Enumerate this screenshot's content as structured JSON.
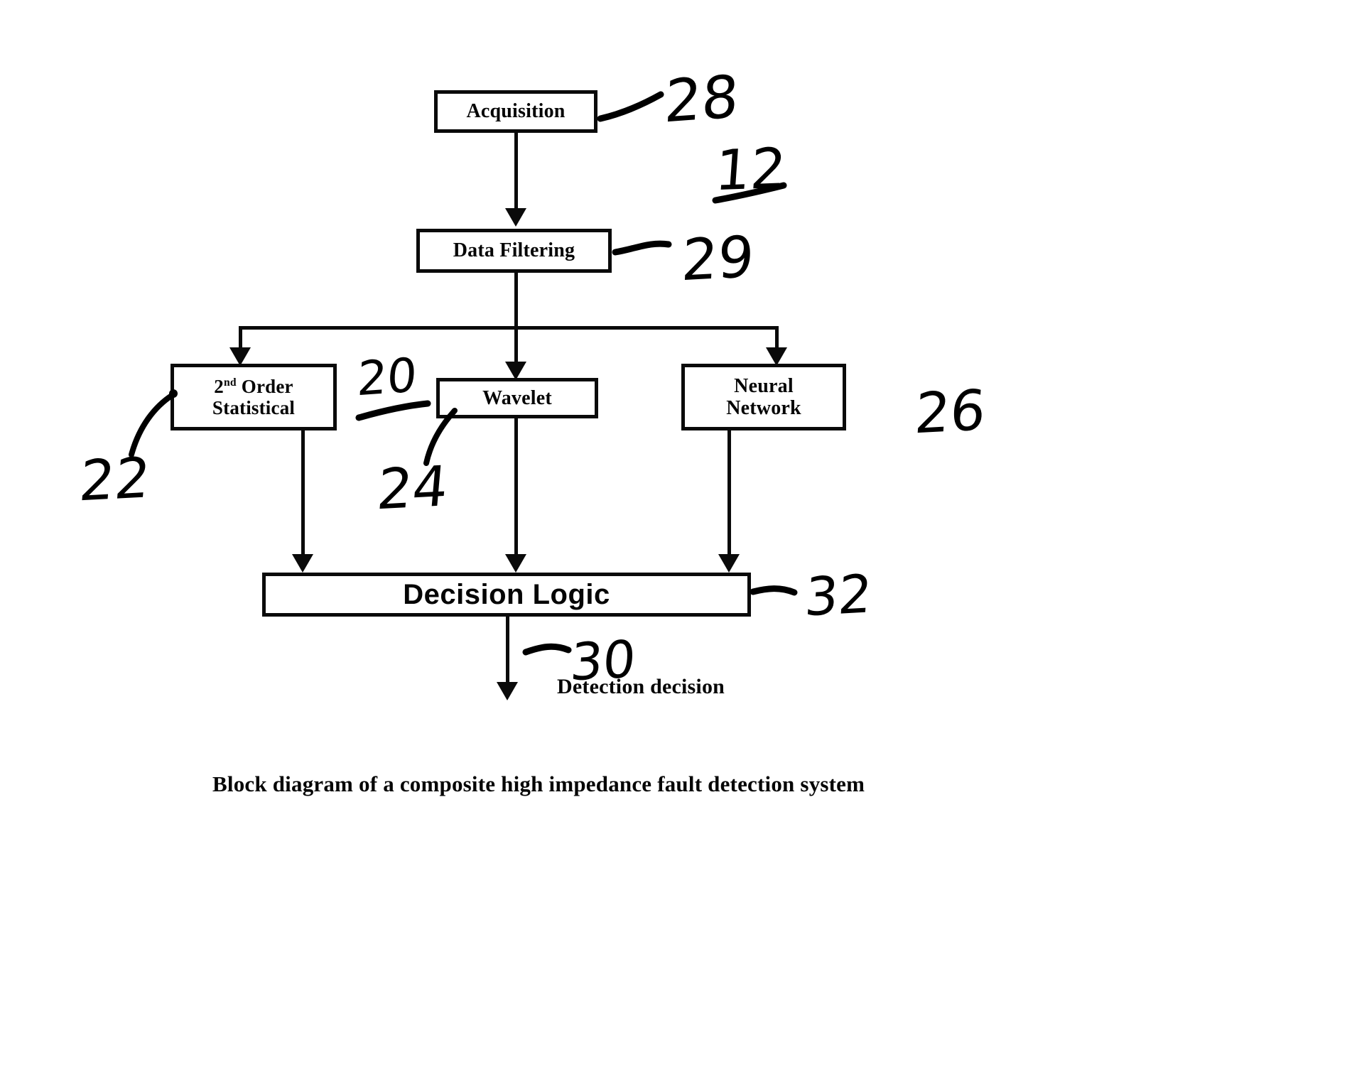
{
  "figure": {
    "caption": "Block diagram of a composite high impedance fault detection system",
    "output_label": "Detection decision"
  },
  "blocks": [
    {
      "id": "acquisition",
      "label": "Acquisition",
      "ref": "28"
    },
    {
      "id": "data_filtering",
      "label": "Data Filtering",
      "ref": "29"
    },
    {
      "id": "second_order",
      "label_line1": "2",
      "label_sup": "nd",
      "label_line1b": " Order",
      "label_line2": "Statistical",
      "ref": "22"
    },
    {
      "id": "wavelet",
      "label": "Wavelet",
      "ref": "24"
    },
    {
      "id": "neural",
      "label_line1": "Neural",
      "label_line2": "Network",
      "ref": "26"
    },
    {
      "id": "decision",
      "label": "Decision Logic",
      "ref": "32"
    }
  ],
  "reference_numerals": {
    "system": "12",
    "analysis_group": "20",
    "second_order": "22",
    "wavelet": "24",
    "neural_network": "26",
    "acquisition": "28",
    "data_filtering": "29",
    "detection_decision": "30",
    "decision_logic": "32"
  },
  "colors": {
    "ink": "#0a0a0a",
    "background": "#ffffff"
  },
  "chart_data": {
    "type": "diagram",
    "title": "Block diagram of a composite high impedance fault detection system",
    "nodes": [
      {
        "id": "acquisition",
        "label": "Acquisition",
        "ref": "28"
      },
      {
        "id": "data_filtering",
        "label": "Data Filtering",
        "ref": "29"
      },
      {
        "id": "second_order",
        "label": "2nd Order Statistical",
        "ref": "22"
      },
      {
        "id": "wavelet",
        "label": "Wavelet",
        "ref": "24"
      },
      {
        "id": "neural_network",
        "label": "Neural Network",
        "ref": "26"
      },
      {
        "id": "decision_logic",
        "label": "Decision Logic",
        "ref": "32"
      },
      {
        "id": "output",
        "label": "Detection decision",
        "ref": "30"
      }
    ],
    "edges": [
      {
        "from": "acquisition",
        "to": "data_filtering"
      },
      {
        "from": "data_filtering",
        "to": "second_order"
      },
      {
        "from": "data_filtering",
        "to": "wavelet"
      },
      {
        "from": "data_filtering",
        "to": "neural_network"
      },
      {
        "from": "second_order",
        "to": "decision_logic"
      },
      {
        "from": "wavelet",
        "to": "decision_logic"
      },
      {
        "from": "neural_network",
        "to": "decision_logic"
      },
      {
        "from": "decision_logic",
        "to": "output"
      }
    ]
  }
}
